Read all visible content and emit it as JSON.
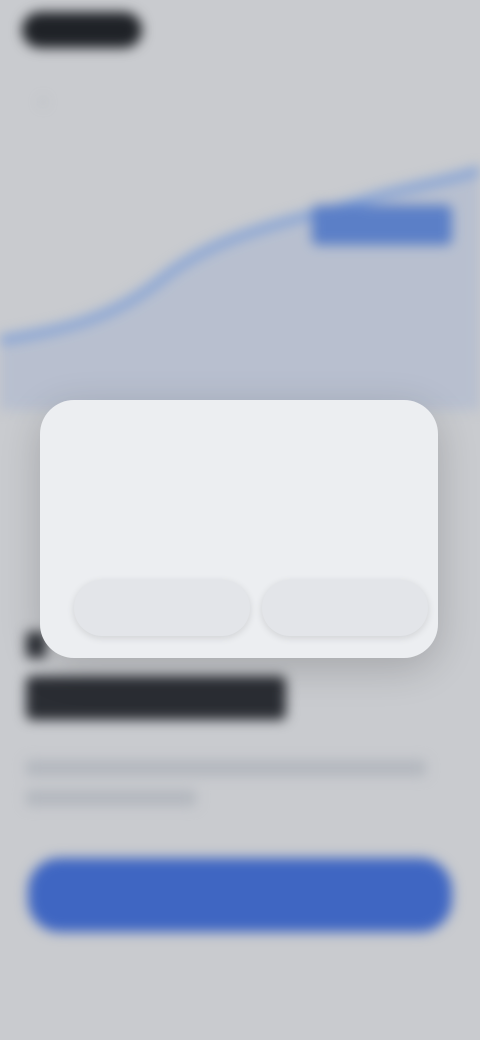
{
  "status_bar": {
    "time": "",
    "icons": ""
  },
  "nav": {
    "back_icon": "chevron-left-icon"
  },
  "chart": {
    "badge_value": "",
    "caption": ""
  },
  "content": {
    "headline": "",
    "body_lines": [
      "",
      ""
    ]
  },
  "actions": {
    "primary_label": "",
    "secondary_label": ""
  },
  "dialog": {
    "title": "",
    "message": "",
    "left_button": "",
    "right_button": ""
  },
  "colors": {
    "accent": "#3f66c2",
    "chart_line": "#7f9fd6",
    "dialog_bg": "#eceef1",
    "background": "#c9cbcf"
  }
}
